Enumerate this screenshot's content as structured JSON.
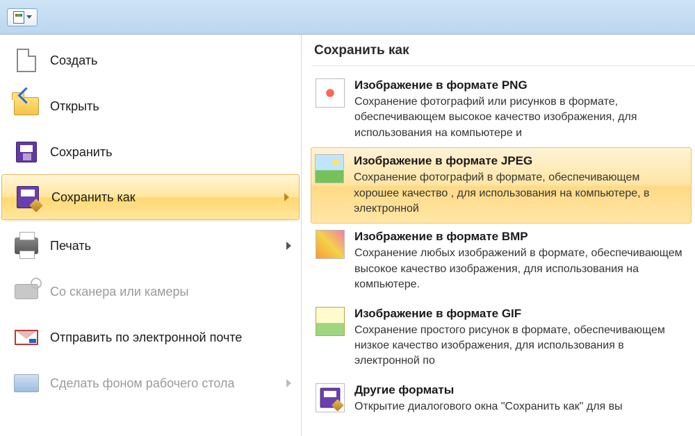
{
  "titlebar": {},
  "left_menu": {
    "items": [
      {
        "key": "new",
        "label": "Создать",
        "disabled": false,
        "has_sub": false
      },
      {
        "key": "open",
        "label": "Открыть",
        "disabled": false,
        "has_sub": false
      },
      {
        "key": "save",
        "label": "Сохранить",
        "disabled": false,
        "has_sub": false
      },
      {
        "key": "saveas",
        "label": "Сохранить как",
        "disabled": false,
        "has_sub": true,
        "selected": true
      },
      {
        "key": "print",
        "label": "Печать",
        "disabled": false,
        "has_sub": true
      },
      {
        "key": "scanner",
        "label": "Со сканера или камеры",
        "disabled": true,
        "has_sub": false
      },
      {
        "key": "email",
        "label": "Отправить по электронной почте",
        "disabled": false,
        "has_sub": false
      },
      {
        "key": "wallpaper",
        "label": "Сделать фоном рабочего стола",
        "disabled": true,
        "has_sub": true
      }
    ]
  },
  "right_panel": {
    "title": "Сохранить как",
    "options": [
      {
        "key": "png",
        "title": "Изображение в формате PNG",
        "desc": "Сохранение фотографий или рисунков в формате, обеспечивающем высокое качество изображения, для использования на компьютере и"
      },
      {
        "key": "jpeg",
        "title": "Изображение в формате JPEG",
        "desc": "Сохранение фотографий в формате, обеспечивающем хорошее качество , для использования на компьютере, в электронной",
        "highlight": true
      },
      {
        "key": "bmp",
        "title": "Изображение в формате BMP",
        "desc": "Сохранение любых изображений в формате, обеспечивающем высокое качество изображения, для использования на компьютере."
      },
      {
        "key": "gif",
        "title": "Изображение в формате GIF",
        "desc": "Сохранение простого рисунок в формате, обеспечивающем низкое качество изображения, для использования в электронной по"
      },
      {
        "key": "other",
        "title": "Другие форматы",
        "desc": "Открытие диалогового окна \"Сохранить как\" для вы"
      }
    ]
  }
}
